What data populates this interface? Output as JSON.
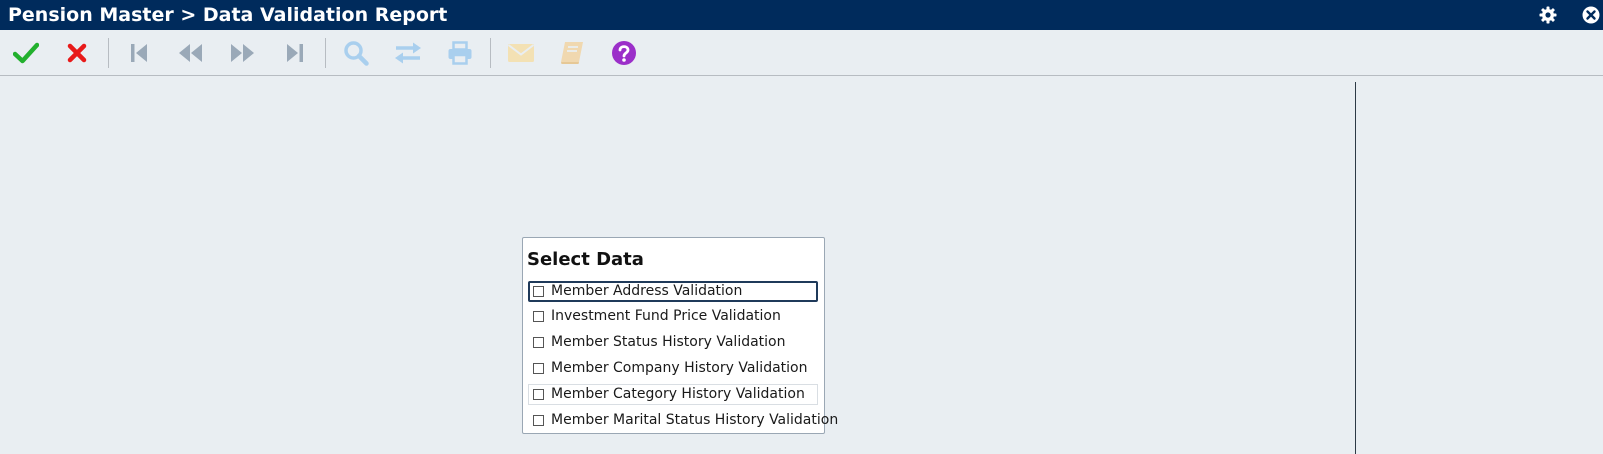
{
  "window": {
    "title": "Pension Master > Data Validation Report",
    "header_bg": "#002b5c"
  },
  "toolbar": {
    "buttons": [
      {
        "name": "accept",
        "icon": "checkmark-icon",
        "color": "#22b02e",
        "enabled": true
      },
      {
        "name": "cancel",
        "icon": "close-x-icon",
        "color": "#e81a1a",
        "enabled": true
      },
      {
        "name": "first-record",
        "icon": "skip-first-icon",
        "color": "#9aa9b8",
        "enabled": false
      },
      {
        "name": "previous-record",
        "icon": "rewind-icon",
        "color": "#9aa9b8",
        "enabled": false
      },
      {
        "name": "next-record",
        "icon": "fast-forward-icon",
        "color": "#9aa9b8",
        "enabled": false
      },
      {
        "name": "last-record",
        "icon": "skip-last-icon",
        "color": "#9aa9b8",
        "enabled": false
      },
      {
        "name": "search",
        "icon": "magnifier-icon",
        "color": "#a9cfee",
        "enabled": false
      },
      {
        "name": "exchange",
        "icon": "swap-arrows-icon",
        "color": "#a9cfee",
        "enabled": false
      },
      {
        "name": "print",
        "icon": "printer-icon",
        "color": "#a9cfee",
        "enabled": false
      },
      {
        "name": "email",
        "icon": "envelope-icon",
        "color": "#f3e1b4",
        "enabled": false
      },
      {
        "name": "book",
        "icon": "book-icon",
        "color": "#f0d8b0",
        "enabled": false
      },
      {
        "name": "help",
        "icon": "help-circle-icon",
        "color": "#9b2fc9",
        "enabled": true
      }
    ]
  },
  "select_data": {
    "title": "Select Data",
    "options": [
      {
        "label": "Member Address Validation",
        "checked": false
      },
      {
        "label": "Investment Fund Price Validation",
        "checked": false
      },
      {
        "label": "Member Status History Validation",
        "checked": false
      },
      {
        "label": "Member Company History Validation",
        "checked": false
      },
      {
        "label": "Member Category History Validation",
        "checked": false
      },
      {
        "label": "Member Marital Status History Validation",
        "checked": false
      }
    ]
  }
}
